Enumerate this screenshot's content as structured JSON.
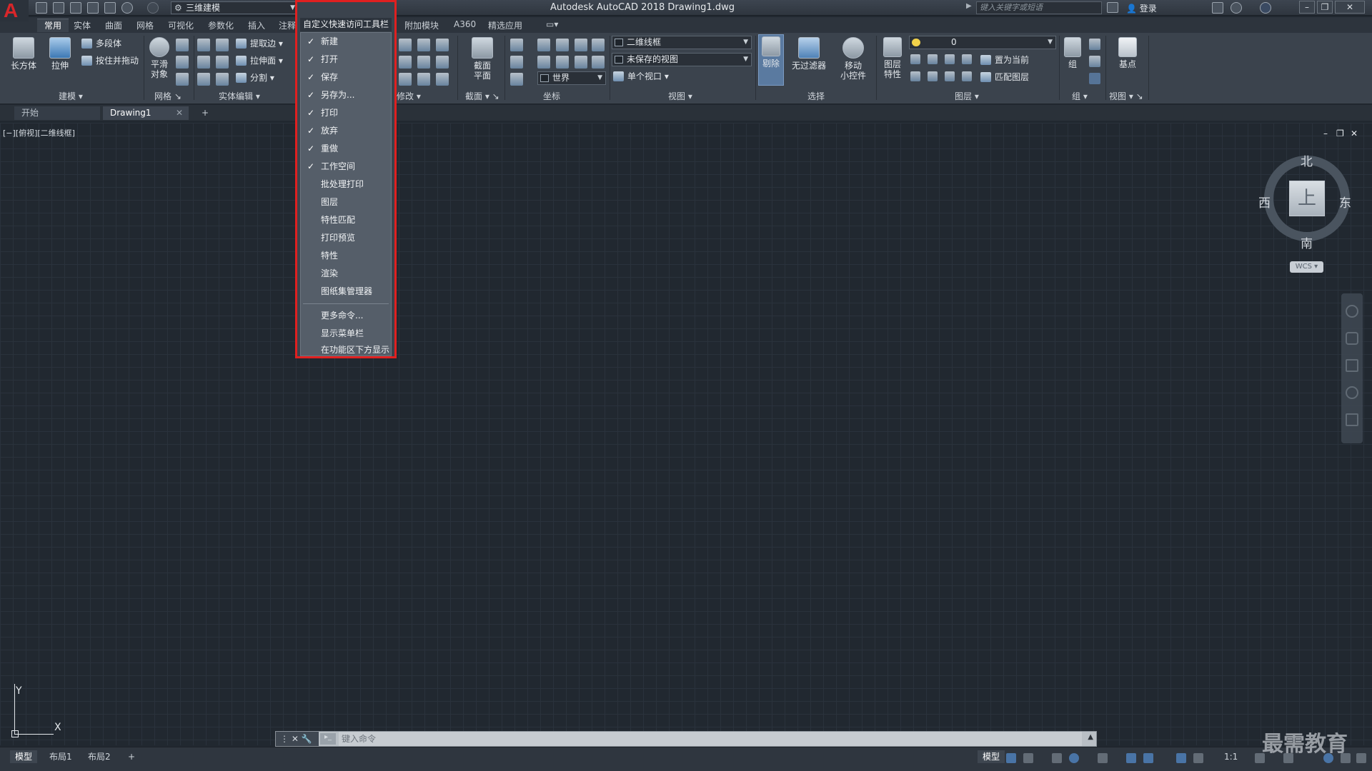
{
  "app": {
    "logo": "A",
    "window_title": "Autodesk AutoCAD 2018    Drawing1.dwg",
    "workspace": "三维建模",
    "search_placeholder": "键入关键字或短语",
    "login": "登录"
  },
  "ribbon_tabs": [
    "常用",
    "实体",
    "曲面",
    "网格",
    "可视化",
    "参数化",
    "插入",
    "注释",
    "附加模块",
    "A360",
    "精选应用"
  ],
  "ribbon": {
    "modeling": {
      "box": "长方体",
      "extrude": "拉伸",
      "polysolid": "多段体",
      "presspull": "按住并拖动",
      "title": "建模"
    },
    "mesh": {
      "smooth_line1": "平滑",
      "smooth_line2": "对象",
      "title": "网格"
    },
    "solid_editing": {
      "extract_edges": "提取边",
      "extrude_faces": "拉伸面",
      "separate": "分割",
      "title": "实体编辑"
    },
    "modify": {
      "title": "修改"
    },
    "section": {
      "plane_line1": "截面",
      "plane_line2": "平面",
      "title": "截面"
    },
    "coordinates": {
      "world": "世界",
      "title": "坐标"
    },
    "view": {
      "visual_style": "二维线框",
      "saved_view": "未保存的视图",
      "single_viewport": "单个视口",
      "title": "视图"
    },
    "selection": {
      "culling": "剔除",
      "no_filter": "无过滤器",
      "gizmo_line1": "移动",
      "gizmo_line2": "小控件",
      "title": "选择"
    },
    "layers": {
      "props_line1": "图层",
      "props_line2": "特性",
      "current_layer": "0",
      "make_current": "置为当前",
      "match_layer": "匹配图层",
      "title": "图层"
    },
    "groups": {
      "group": "组",
      "title": "组"
    },
    "view2": {
      "base": "基点",
      "title": "视图"
    }
  },
  "file_tabs": {
    "start": "开始",
    "drawing": "Drawing1",
    "add": "+"
  },
  "viewport": {
    "label": "[−][俯视][二维线框]",
    "compass": {
      "north": "北",
      "south": "南",
      "east": "东",
      "west": "西",
      "top": "上"
    },
    "wcs": "WCS ▾",
    "ucs_x": "X",
    "ucs_y": "Y"
  },
  "command_line": {
    "placeholder": "键入命令"
  },
  "layout_tabs": [
    "模型",
    "布局1",
    "布局2"
  ],
  "status": {
    "model": "模型",
    "scale": "1:1"
  },
  "watermark": "最需教育",
  "qat_menu": {
    "header": "自定义快速访问工具栏",
    "items": [
      {
        "label": "新建",
        "checked": "✓"
      },
      {
        "label": "打开",
        "checked": "✓"
      },
      {
        "label": "保存",
        "checked": "✓"
      },
      {
        "label": "另存为...",
        "checked": "✓"
      },
      {
        "label": "打印",
        "checked": "✓"
      },
      {
        "label": "放弃",
        "checked": "✓"
      },
      {
        "label": "重做",
        "checked": "✓"
      },
      {
        "label": "工作空间",
        "checked": "✓"
      },
      {
        "label": "批处理打印",
        "checked": ""
      },
      {
        "label": "图层",
        "checked": ""
      },
      {
        "label": "特性匹配",
        "checked": ""
      },
      {
        "label": "打印预览",
        "checked": ""
      },
      {
        "label": "特性",
        "checked": ""
      },
      {
        "label": "渲染",
        "checked": ""
      },
      {
        "label": "图纸集管理器",
        "checked": ""
      }
    ],
    "extra": [
      "更多命令...",
      "显示菜单栏",
      "在功能区下方显示"
    ]
  }
}
